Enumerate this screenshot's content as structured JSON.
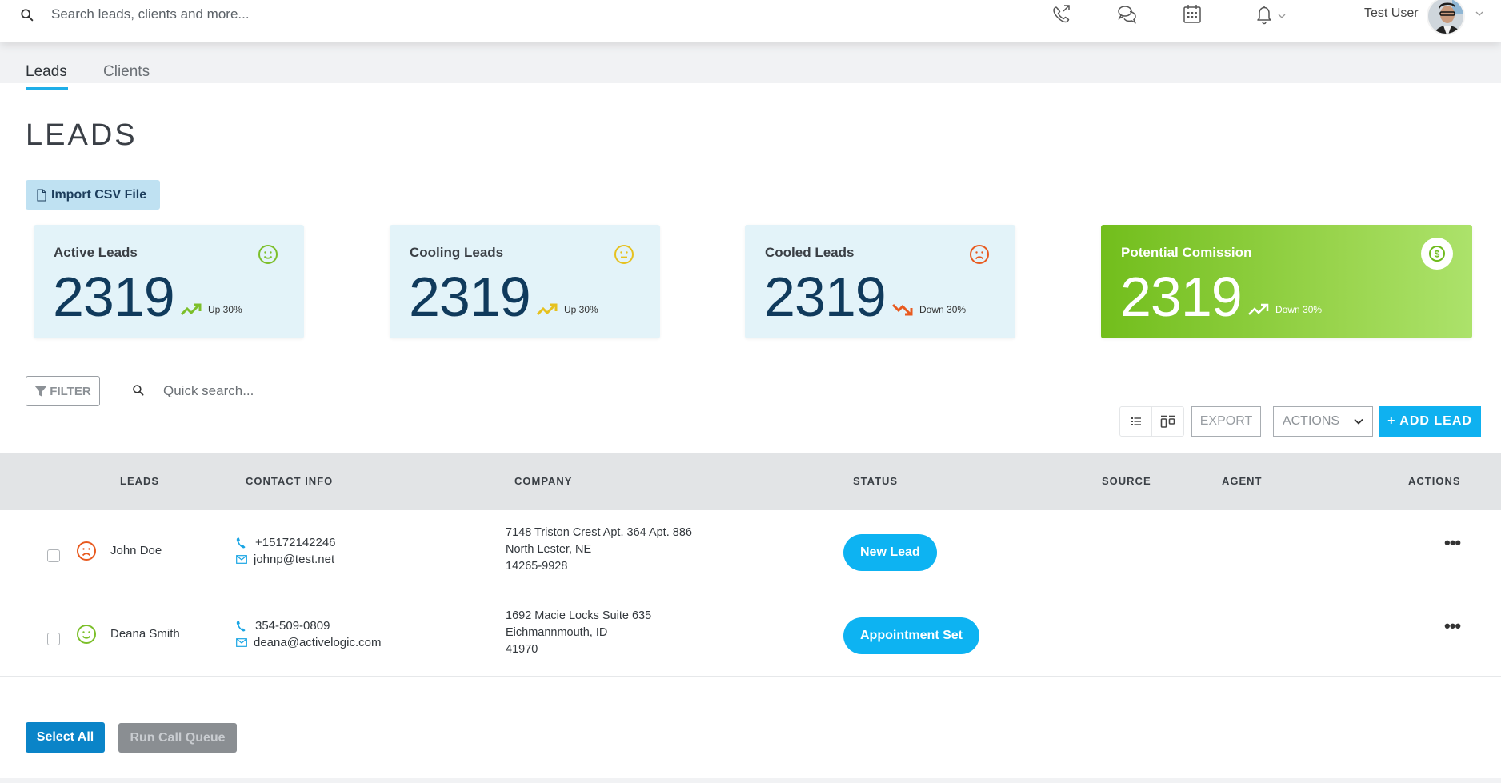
{
  "topbar": {
    "search_placeholder": "Search leads, clients and more...",
    "icons": [
      "outgoing-call-icon",
      "chat-icon",
      "calendar-icon",
      "bell-icon"
    ],
    "user_name": "Test User"
  },
  "tabs": [
    {
      "label": "Leads",
      "active": true
    },
    {
      "label": "Clients",
      "active": false
    }
  ],
  "page_title": "LEADS",
  "import_button": "Import CSV File",
  "cards": [
    {
      "title": "Active Leads",
      "value": "2319",
      "trend": "Up 30%",
      "trend_dir": "up",
      "mood": "happy",
      "color": "#7cbf2a"
    },
    {
      "title": "Cooling Leads",
      "value": "2319",
      "trend": "Up 30%",
      "trend_dir": "up",
      "mood": "neutral",
      "color": "#e6c11f"
    },
    {
      "title": "Cooled Leads",
      "value": "2319",
      "trend": "Down 30%",
      "trend_dir": "down",
      "mood": "sad",
      "color": "#e85a1f"
    },
    {
      "title": "Potential Comission",
      "value": "2319",
      "trend": "Down 30%",
      "trend_dir": "up",
      "mood": "dollar",
      "color": "#ffffff"
    }
  ],
  "filter_label": "FILTER",
  "quick_search_placeholder": "Quick search...",
  "toolbar": {
    "export_label": "EXPORT",
    "actions_label": "ACTIONS",
    "add_label": "+ ADD LEAD"
  },
  "table": {
    "headers": [
      "LEADS",
      "CONTACT INFO",
      "COMPANY",
      "STATUS",
      "SOURCE",
      "AGENT",
      "ACTIONS"
    ],
    "rows": [
      {
        "mood": "sad",
        "name": "John Doe",
        "phone": "+15172142246",
        "email": "johnp@test.net",
        "address": [
          "7148 Triston Crest Apt. 364 Apt. 886",
          "North Lester, NE",
          "14265-9928"
        ],
        "status": "New Lead",
        "source": "",
        "agent": ""
      },
      {
        "mood": "happy",
        "name": "Deana Smith",
        "phone": "354-509-0809",
        "email": "deana@activelogic.com",
        "address": [
          "1692 Macie Locks Suite 635",
          "Eichmannmouth, ID",
          "41970"
        ],
        "status": "Appointment Set",
        "source": "",
        "agent": ""
      }
    ]
  },
  "footer": {
    "select_all": "Select All",
    "run_call_queue": "Run Call Queue"
  },
  "colors": {
    "accent": "#0fb1f0",
    "tab_underline": "#1eaee8",
    "happy": "#7cbf2a",
    "neutral": "#e6c11f",
    "sad": "#e85a1f",
    "select_all": "#0a84c8"
  }
}
